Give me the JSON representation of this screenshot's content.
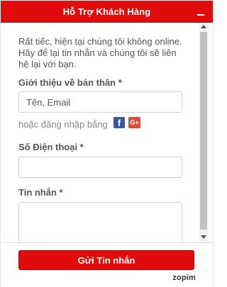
{
  "header": {
    "title": "Hỗ Trợ Khách Hàng",
    "minimize_icon": "minimize-icon"
  },
  "form": {
    "intro": "Rất tiếc, hiện tại chúng tôi không online. Hãy để lại tin nhắn và chúng tôi sẽ liên hệ lại với bạn.",
    "about_label": "Giới thiệu về bản thân *",
    "about_placeholder": "Tên, Email",
    "social_text": "hoặc đăng nhập bằng",
    "facebook_icon": "f",
    "gplus_icon": "G+",
    "phone_label": "Số Điện thoại *",
    "phone_value": "",
    "message_label": "Tin nhắn *",
    "message_value": ""
  },
  "footer": {
    "send_label": "Gửi Tin nhắn",
    "brand": "zopim"
  },
  "colors": {
    "accent": "#e10b0b",
    "facebook": "#3b5998",
    "gplus": "#dd4b39"
  }
}
